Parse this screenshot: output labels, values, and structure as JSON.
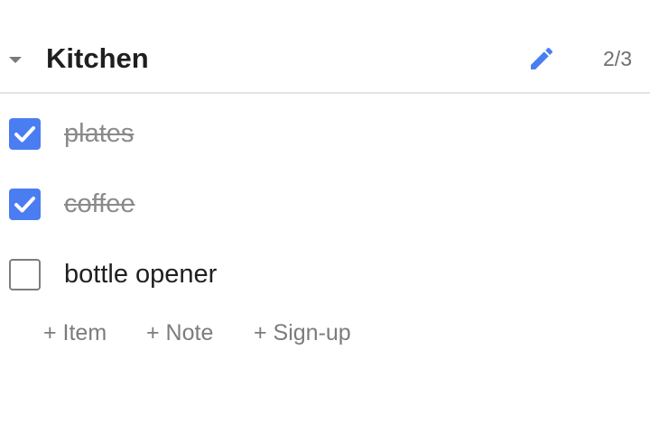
{
  "section": {
    "title": "Kitchen",
    "count": "2/3",
    "icons": {
      "collapse": "caret-down-icon",
      "edit": "pencil-icon"
    },
    "colors": {
      "accent": "#4a7df2"
    }
  },
  "items": [
    {
      "label": "plates",
      "checked": true
    },
    {
      "label": "coffee",
      "checked": true
    },
    {
      "label": "bottle opener",
      "checked": false
    }
  ],
  "actions": {
    "add_item": "+ Item",
    "add_note": "+ Note",
    "add_signup": "+ Sign-up"
  }
}
